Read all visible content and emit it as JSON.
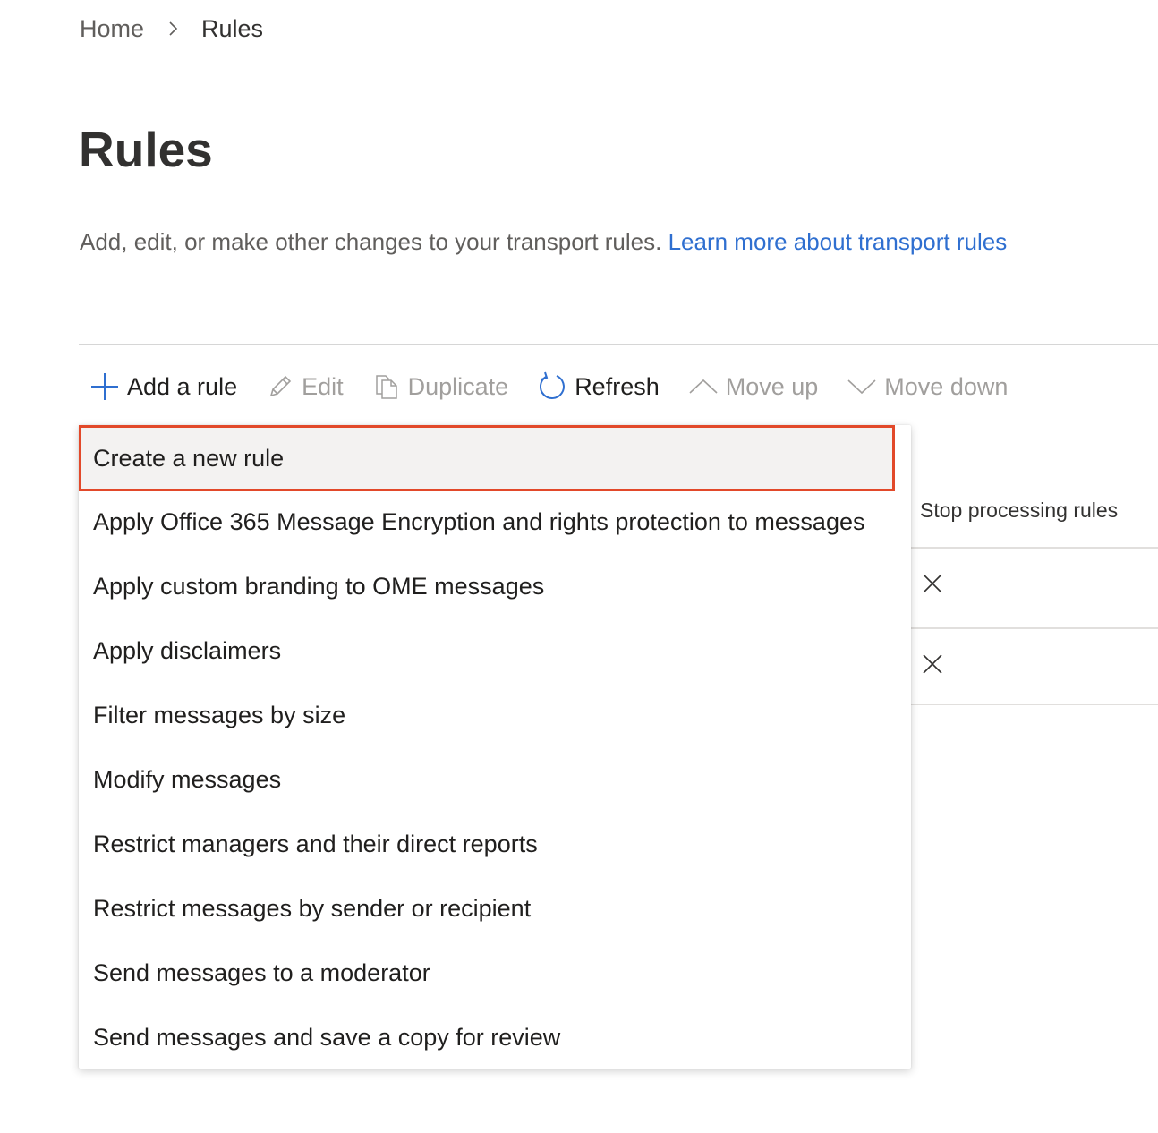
{
  "breadcrumb": {
    "home": "Home",
    "current": "Rules"
  },
  "page": {
    "title": "Rules",
    "description": "Add, edit, or make other changes to your transport rules.",
    "learn_more_link": "Learn more about transport rules"
  },
  "commandbar": {
    "add_rule": "Add a rule",
    "edit": "Edit",
    "duplicate": "Duplicate",
    "refresh": "Refresh",
    "move_up": "Move up",
    "move_down": "Move down"
  },
  "table": {
    "column_stop_processing": "Stop processing rules"
  },
  "menu": {
    "items": [
      "Create a new rule",
      "Apply Office 365 Message Encryption and rights protection to messages",
      "Apply custom branding to OME messages",
      "Apply disclaimers",
      "Filter messages by size",
      "Modify messages",
      "Restrict managers and their direct reports",
      "Restrict messages by sender or recipient",
      "Send messages to a moderator",
      "Send messages and save a copy for review"
    ]
  },
  "colors": {
    "accent": "#2f6fd0",
    "highlight_border": "#e2492a",
    "disabled_text": "#a19f9d"
  }
}
